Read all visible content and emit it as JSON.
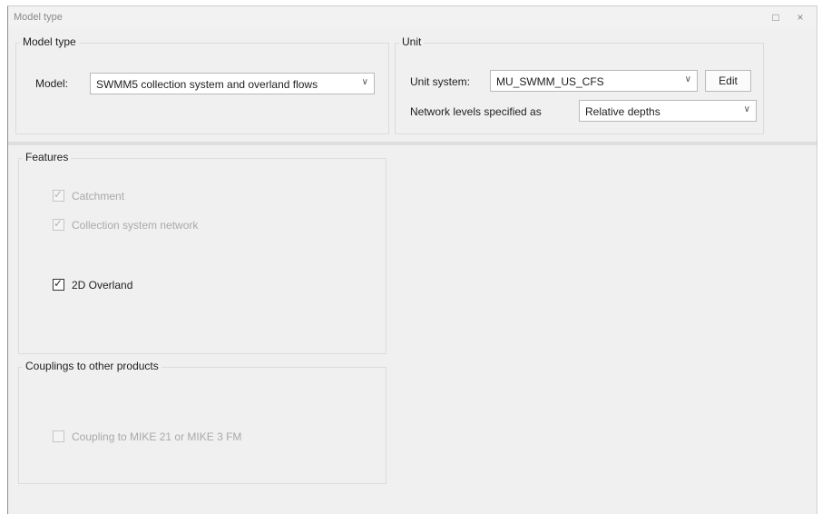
{
  "window": {
    "title": "Model type",
    "restore_glyph": "□",
    "close_glyph": "×"
  },
  "model_type": {
    "legend": "Model type",
    "model_label": "Model:",
    "model_value": "SWMM5 collection system and overland flows"
  },
  "unit": {
    "legend": "Unit",
    "unit_system_label": "Unit system:",
    "unit_system_value": "MU_SWMM_US_CFS",
    "edit_label": "Edit",
    "network_levels_label": "Network levels specified as",
    "network_levels_value": "Relative depths"
  },
  "features": {
    "legend": "Features",
    "items": [
      {
        "label": "Catchment",
        "checked": true,
        "enabled": false
      },
      {
        "label": "Collection system network",
        "checked": true,
        "enabled": false
      },
      {
        "label": "2D Overland",
        "checked": true,
        "enabled": true
      }
    ]
  },
  "couplings": {
    "legend": "Couplings to other products",
    "items": [
      {
        "label": "Coupling to MIKE 21 or MIKE 3 FM",
        "checked": false,
        "enabled": false
      }
    ]
  },
  "icons": {
    "dropdown": "chevron-down-icon",
    "check": "checkmark-icon"
  }
}
